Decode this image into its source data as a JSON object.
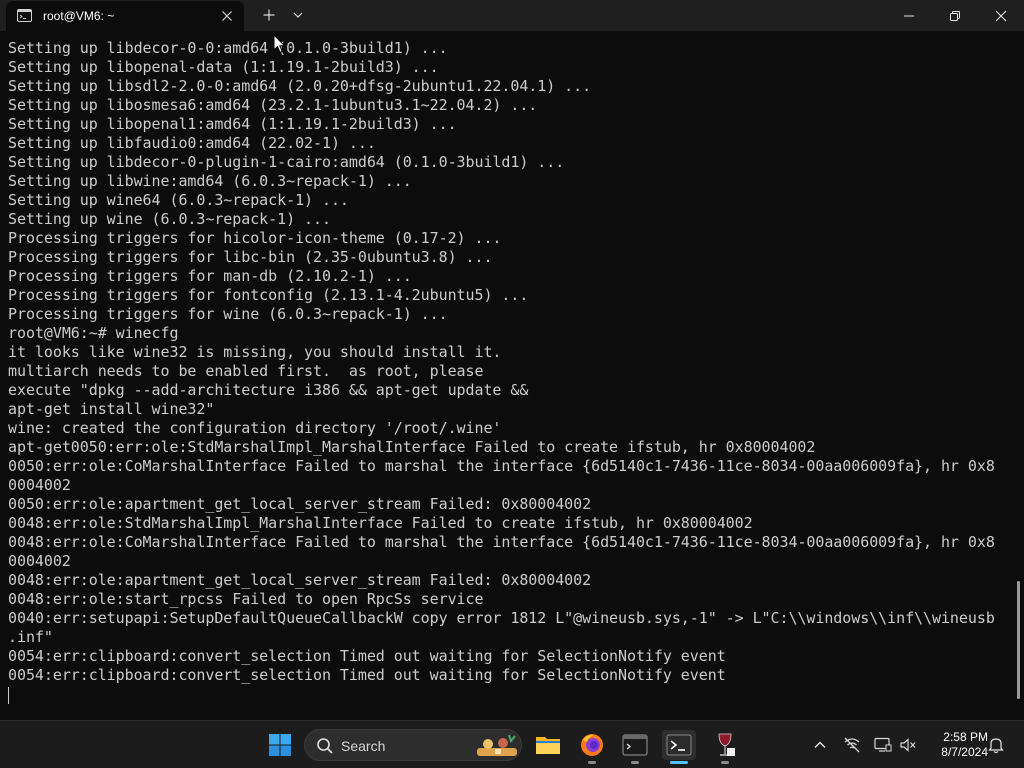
{
  "window": {
    "tab_title": "root@VM6: ~",
    "icons": {
      "tab": "terminal-icon",
      "close_tab": "close-icon",
      "new_tab": "plus-icon",
      "dropdown": "chevron-down-icon",
      "minimize": "minimize-icon",
      "maximize": "restore-icon",
      "close": "close-icon"
    }
  },
  "terminal": {
    "lines": [
      "Setting up libdecor-0-0:amd64 (0.1.0-3build1) ...",
      "Setting up libopenal-data (1:1.19.1-2build3) ...",
      "Setting up libsdl2-2.0-0:amd64 (2.0.20+dfsg-2ubuntu1.22.04.1) ...",
      "Setting up libosmesa6:amd64 (23.2.1-1ubuntu3.1~22.04.2) ...",
      "Setting up libopenal1:amd64 (1:1.19.1-2build3) ...",
      "Setting up libfaudio0:amd64 (22.02-1) ...",
      "Setting up libdecor-0-plugin-1-cairo:amd64 (0.1.0-3build1) ...",
      "Setting up libwine:amd64 (6.0.3~repack-1) ...",
      "Setting up wine64 (6.0.3~repack-1) ...",
      "Setting up wine (6.0.3~repack-1) ...",
      "Processing triggers for hicolor-icon-theme (0.17-2) ...",
      "Processing triggers for libc-bin (2.35-0ubuntu3.8) ...",
      "Processing triggers for man-db (2.10.2-1) ...",
      "Processing triggers for fontconfig (2.13.1-4.2ubuntu5) ...",
      "Processing triggers for wine (6.0.3~repack-1) ...",
      "root@VM6:~# winecfg",
      "it looks like wine32 is missing, you should install it.",
      "multiarch needs to be enabled first.  as root, please",
      "execute \"dpkg --add-architecture i386 && apt-get update &&",
      "apt-get install wine32\"",
      "wine: created the configuration directory '/root/.wine'",
      "apt-get0050:err:ole:StdMarshalImpl_MarshalInterface Failed to create ifstub, hr 0x80004002",
      "0050:err:ole:CoMarshalInterface Failed to marshal the interface {6d5140c1-7436-11ce-8034-00aa006009fa}, hr 0x8",
      "0004002",
      "0050:err:ole:apartment_get_local_server_stream Failed: 0x80004002",
      "0048:err:ole:StdMarshalImpl_MarshalInterface Failed to create ifstub, hr 0x80004002",
      "0048:err:ole:CoMarshalInterface Failed to marshal the interface {6d5140c1-7436-11ce-8034-00aa006009fa}, hr 0x8",
      "0004002",
      "0048:err:ole:apartment_get_local_server_stream Failed: 0x80004002",
      "0048:err:ole:start_rpcss Failed to open RpcSs service",
      "0040:err:setupapi:SetupDefaultQueueCallbackW copy error 1812 L\"@wineusb.sys,-1\" -> L\"C:\\\\windows\\\\inf\\\\wineusb",
      ".inf\"",
      "0054:err:clipboard:convert_selection Timed out waiting for SelectionNotify event",
      "0054:err:clipboard:convert_selection Timed out waiting for SelectionNotify event"
    ]
  },
  "taskbar": {
    "search_placeholder": "Search",
    "apps": [
      "windows-start-icon",
      "search-icon",
      "file-explorer-icon",
      "firefox-icon",
      "terminal-app-icon",
      "windows-terminal-icon",
      "wine-icon"
    ],
    "tray": [
      "chevron-up-icon",
      "network-off-icon",
      "display-icon",
      "speaker-muted-icon",
      "notification-bell-icon"
    ],
    "time": "2:58 PM",
    "date": "8/7/2024"
  },
  "colors": {
    "terminal_bg": "#0c0c0c",
    "terminal_text": "#cccccc",
    "titlebar_bg": "#1f1f1f",
    "taskbar_bg": "#1c1c1c",
    "accent": "#4cc2ff"
  }
}
